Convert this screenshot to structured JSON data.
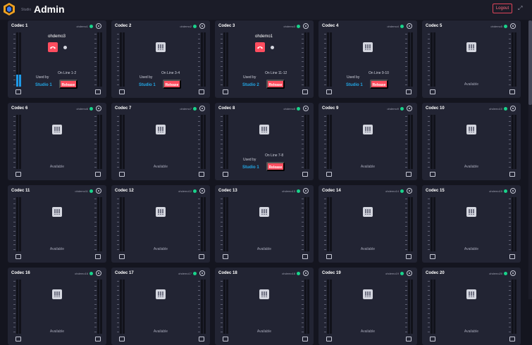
{
  "header": {
    "logo_small": "Studio",
    "title": "Admin",
    "logout_label": "Logout"
  },
  "codecs": [
    {
      "name": "Codec 1",
      "user": "ohdemo1",
      "status": "in-call",
      "remote": "ohdemo3",
      "used_by": "Used by",
      "studio": "Studio 1",
      "online": "On Line 1-2",
      "release": "Release",
      "level": 0.22
    },
    {
      "name": "Codec 2",
      "user": "ohdemo2",
      "status": "used",
      "used_by": "Used by",
      "studio": "Studio 1",
      "online": "On Line 3-4",
      "release": "Release",
      "level": 0
    },
    {
      "name": "Codec 3",
      "user": "ohdemo3",
      "status": "in-call",
      "remote": "ohdemo1",
      "used_by": "Used by",
      "studio": "Studio 2",
      "online": "On Line 11-12",
      "release": "Release",
      "level": 0
    },
    {
      "name": "Codec 4",
      "user": "ohdemo4",
      "status": "used",
      "used_by": "Used by",
      "studio": "Studio 1",
      "online": "On Line 9-10",
      "release": "Release",
      "level": 0
    },
    {
      "name": "Codec 5",
      "user": "ohdemo5",
      "status": "available",
      "available": "Available",
      "level": 0
    },
    {
      "name": "Codec 6",
      "user": "ohdemo6",
      "status": "available",
      "available": "Available",
      "level": 0
    },
    {
      "name": "Codec 7",
      "user": "ohdemo7",
      "status": "available",
      "available": "Available",
      "level": 0
    },
    {
      "name": "Codec 8",
      "user": "ohdemo8",
      "status": "used",
      "used_by": "Used by",
      "studio": "Studio 1",
      "online": "On Line 7-8",
      "release": "Release",
      "level": 0
    },
    {
      "name": "Codec 9",
      "user": "ohdemo9",
      "status": "available",
      "available": "Available",
      "level": 0
    },
    {
      "name": "Codec 10",
      "user": "ohdemo10",
      "status": "available",
      "available": "Available",
      "level": 0
    },
    {
      "name": "Codec 11",
      "user": "ohdemo11",
      "status": "available",
      "available": "Available",
      "level": 0
    },
    {
      "name": "Codec 12",
      "user": "ohdemo12",
      "status": "available",
      "available": "Available",
      "level": 0
    },
    {
      "name": "Codec 13",
      "user": "ohdemo13",
      "status": "available",
      "available": "Available",
      "level": 0
    },
    {
      "name": "Codec 14",
      "user": "ohdemo14",
      "status": "available",
      "available": "Available",
      "level": 0
    },
    {
      "name": "Codec 15",
      "user": "ohdemo15",
      "status": "available",
      "available": "Available",
      "level": 0
    },
    {
      "name": "Codec 16",
      "user": "ohdemo16",
      "status": "available",
      "available": "Available",
      "level": 0
    },
    {
      "name": "Codec 17",
      "user": "ohdemo17",
      "status": "available",
      "available": "Available",
      "level": 0
    },
    {
      "name": "Codec 18",
      "user": "ohdemo18",
      "status": "available",
      "available": "Available",
      "level": 0
    },
    {
      "name": "Codec 19",
      "user": "ohdemo19",
      "status": "available",
      "available": "Available",
      "level": 0
    },
    {
      "name": "Codec 20",
      "user": "ohdemo20",
      "status": "available",
      "available": "Available",
      "level": 0
    }
  ],
  "colors": {
    "background": "#14151f",
    "card": "#222433",
    "status_green": "#19d38b",
    "release_red": "#ff4d5f",
    "studio_blue": "#22a7e6",
    "meter_blue": "#1e9ae8"
  }
}
